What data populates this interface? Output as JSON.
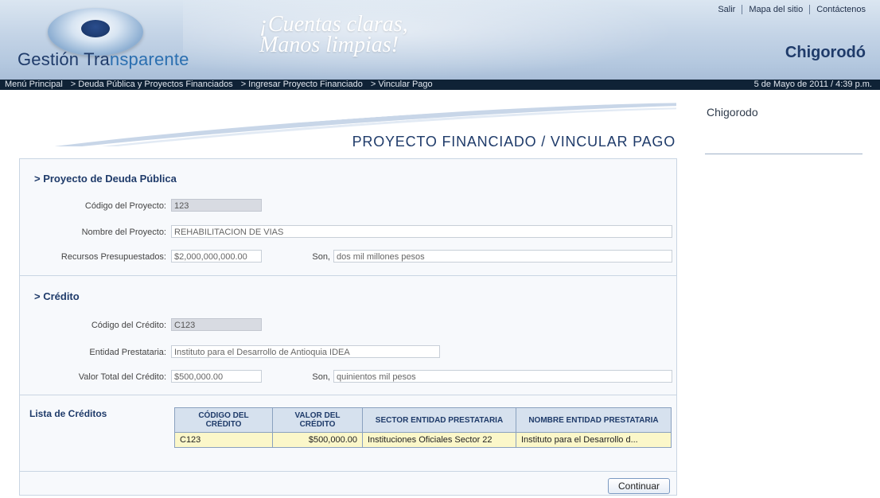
{
  "header": {
    "brand_part1": "Gestión Tra",
    "brand_part2": "nsparente",
    "slogan_line1": "¡Cuentas claras,",
    "slogan_line2": "Manos limpias!",
    "municipality": "Chigorodó",
    "links": [
      "Salir",
      "Mapa del sitio",
      "Contáctenos"
    ]
  },
  "breadcrumb": {
    "items": [
      "Menú Principal",
      "> Deuda Pública y Proyectos Financiados",
      "> Ingresar Proyecto Financiado",
      "> Vincular Pago"
    ],
    "datetime": "5 de Mayo de 2011 / 4:39 p.m."
  },
  "sidebar": {
    "title": "Chigorodo"
  },
  "page_title": "PROYECTO FINANCIADO / VINCULAR PAGO",
  "proyecto": {
    "heading": "> Proyecto de Deuda Pública",
    "codigo_label": "Código del Proyecto:",
    "codigo_value": "123",
    "nombre_label": "Nombre del Proyecto:",
    "nombre_value": "REHABILITACION DE VIAS",
    "recursos_label": "Recursos Presupuestados:",
    "recursos_value": "$2,000,000,000.00",
    "son_label": "Son,",
    "son_value": "dos mil millones  pesos"
  },
  "credito": {
    "heading": "> Crédito",
    "codigo_label": "Código del Crédito:",
    "codigo_value": "C123",
    "entidad_label": "Entidad Prestataria:",
    "entidad_value": "Instituto para el Desarrollo de Antioquia IDEA",
    "valor_label": "Valor Total del Crédito:",
    "valor_value": "$500,000.00",
    "son_label": "Son,",
    "son_value": "quinientos mil pesos"
  },
  "lista": {
    "label": "Lista de Créditos",
    "columns": [
      "CÓDIGO DEL CRÉDITO",
      "VALOR DEL CRÉDITO",
      "SECTOR ENTIDAD PRESTATARIA",
      "NOMBRE ENTIDAD PRESTATARIA"
    ],
    "rows": [
      [
        "C123",
        "$500,000.00",
        "Instituciones Oficiales Sector 22",
        "Instituto para el Desarrollo d..."
      ]
    ]
  },
  "actions": {
    "continue_label": "Continuar"
  }
}
